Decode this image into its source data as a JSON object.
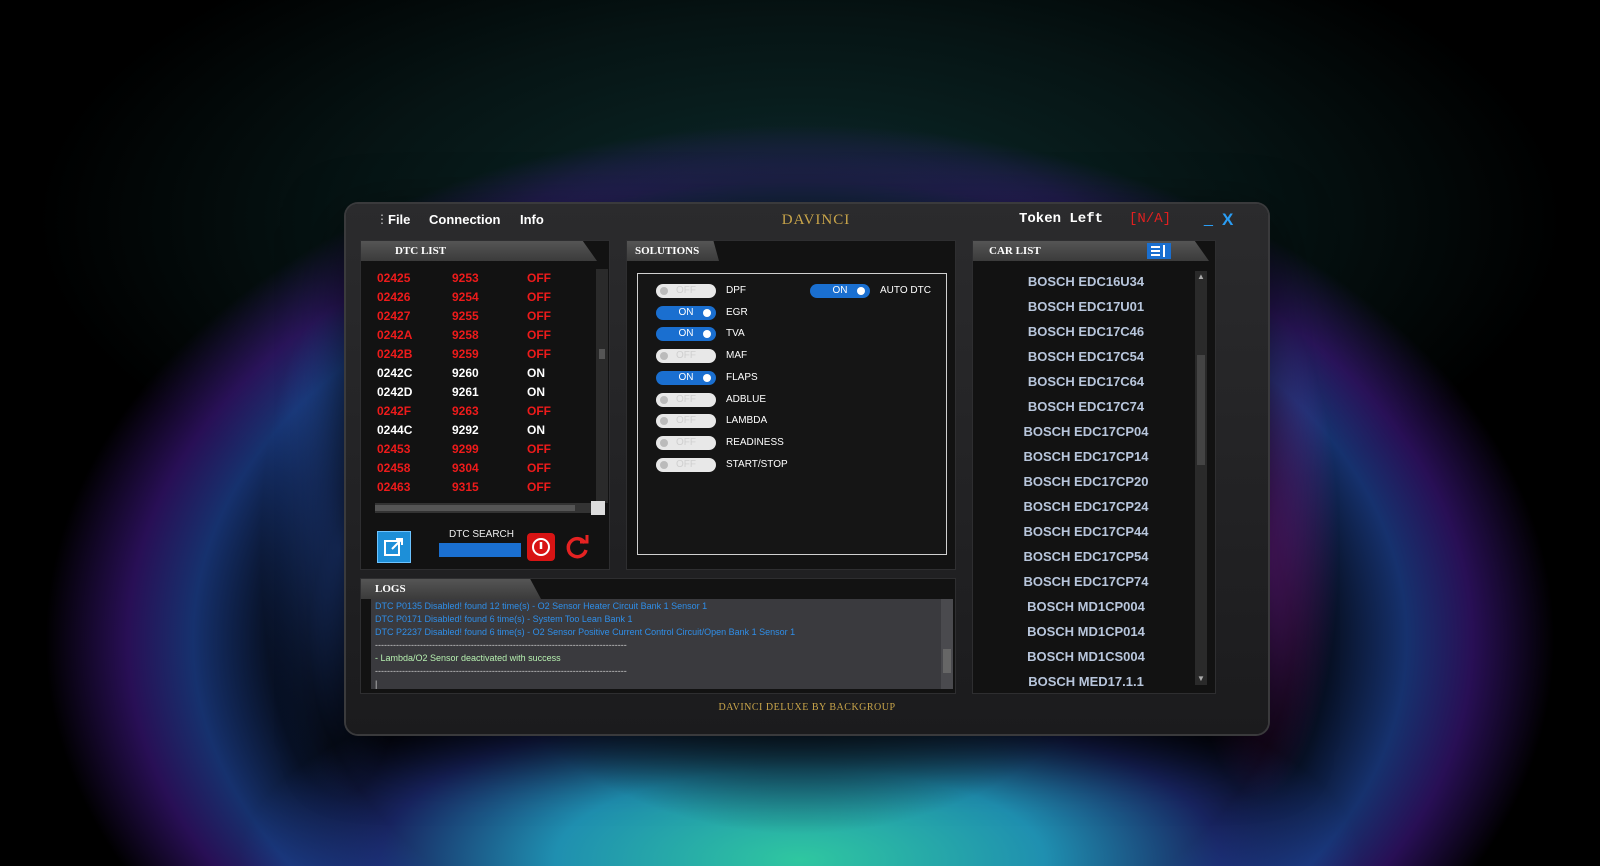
{
  "menu": {
    "file": "File",
    "connection": "Connection",
    "info": "Info"
  },
  "app": {
    "title": "DAVINCI",
    "footer": "DAVINCI DELUXE BY BACKGROUP"
  },
  "token": {
    "label": "Token Left",
    "value": "[N/A]"
  },
  "window": {
    "minimize": "_",
    "close": "X"
  },
  "dtc": {
    "header": "DTC LIST",
    "rows": [
      {
        "code": "02425",
        "num": "9253",
        "state": "OFF"
      },
      {
        "code": "02426",
        "num": "9254",
        "state": "OFF"
      },
      {
        "code": "02427",
        "num": "9255",
        "state": "OFF"
      },
      {
        "code": "0242A",
        "num": "9258",
        "state": "OFF"
      },
      {
        "code": "0242B",
        "num": "9259",
        "state": "OFF"
      },
      {
        "code": "0242C",
        "num": "9260",
        "state": "ON"
      },
      {
        "code": "0242D",
        "num": "9261",
        "state": "ON"
      },
      {
        "code": "0242F",
        "num": "9263",
        "state": "OFF"
      },
      {
        "code": "0244C",
        "num": "9292",
        "state": "ON"
      },
      {
        "code": "02453",
        "num": "9299",
        "state": "OFF"
      },
      {
        "code": "02458",
        "num": "9304",
        "state": "OFF"
      },
      {
        "code": "02463",
        "num": "9315",
        "state": "OFF"
      }
    ],
    "search_label": "DTC SEARCH"
  },
  "solutions": {
    "header": "SOLUTIONS",
    "items": [
      {
        "label": "DPF",
        "state": "OFF"
      },
      {
        "label": "EGR",
        "state": "ON"
      },
      {
        "label": "TVA",
        "state": "ON"
      },
      {
        "label": "MAF",
        "state": "OFF"
      },
      {
        "label": "FLAPS",
        "state": "ON"
      },
      {
        "label": "ADBLUE",
        "state": "OFF"
      },
      {
        "label": "LAMBDA",
        "state": "OFF"
      },
      {
        "label": "READINESS",
        "state": "OFF"
      },
      {
        "label": "START/STOP",
        "state": "OFF"
      }
    ],
    "auto_dtc": {
      "label": "AUTO DTC",
      "state": "ON"
    }
  },
  "cars": {
    "header": "CAR LIST",
    "items": [
      "BOSCH EDC16U34",
      "BOSCH EDC17U01",
      "BOSCH EDC17C46",
      "BOSCH EDC17C54",
      "BOSCH EDC17C64",
      "BOSCH EDC17C74",
      "BOSCH EDC17CP04",
      "BOSCH EDC17CP14",
      "BOSCH EDC17CP20",
      "BOSCH EDC17CP24",
      "BOSCH EDC17CP44",
      "BOSCH EDC17CP54",
      "BOSCH EDC17CP74",
      "BOSCH MD1CP004",
      "BOSCH MD1CP014",
      "BOSCH MD1CS004",
      "BOSCH MED17.1.1"
    ]
  },
  "logs": {
    "header": "LOGS",
    "lines": [
      {
        "text": "DTC P0135 Disabled! found 12 time(s) - O2 Sensor Heater Circuit Bank 1 Sensor 1",
        "kind": "blue"
      },
      {
        "text": "DTC P0171 Disabled! found 6 time(s) - System Too Lean Bank 1",
        "kind": "blue"
      },
      {
        "text": "DTC P2237 Disabled! found 6 time(s) - O2 Sensor Positive Current Control Circuit/Open Bank 1 Sensor 1",
        "kind": "blue"
      },
      {
        "text": "------------------------------------------------------------------------------------",
        "kind": "sep"
      },
      {
        "text": "-  Lambda/O2 Sensor deactivated with success",
        "kind": "green"
      },
      {
        "text": "------------------------------------------------------------------------------------",
        "kind": "sep"
      },
      {
        "text": "|",
        "kind": "sep"
      }
    ]
  },
  "colors": {
    "accent": "#1a6fd0",
    "off_red": "#ee1b1b",
    "gold": "#c9a54a"
  },
  "icons": {
    "open": "external-link-icon",
    "power": "power-icon",
    "refresh": "refresh-icon",
    "list": "list-view-icon"
  }
}
